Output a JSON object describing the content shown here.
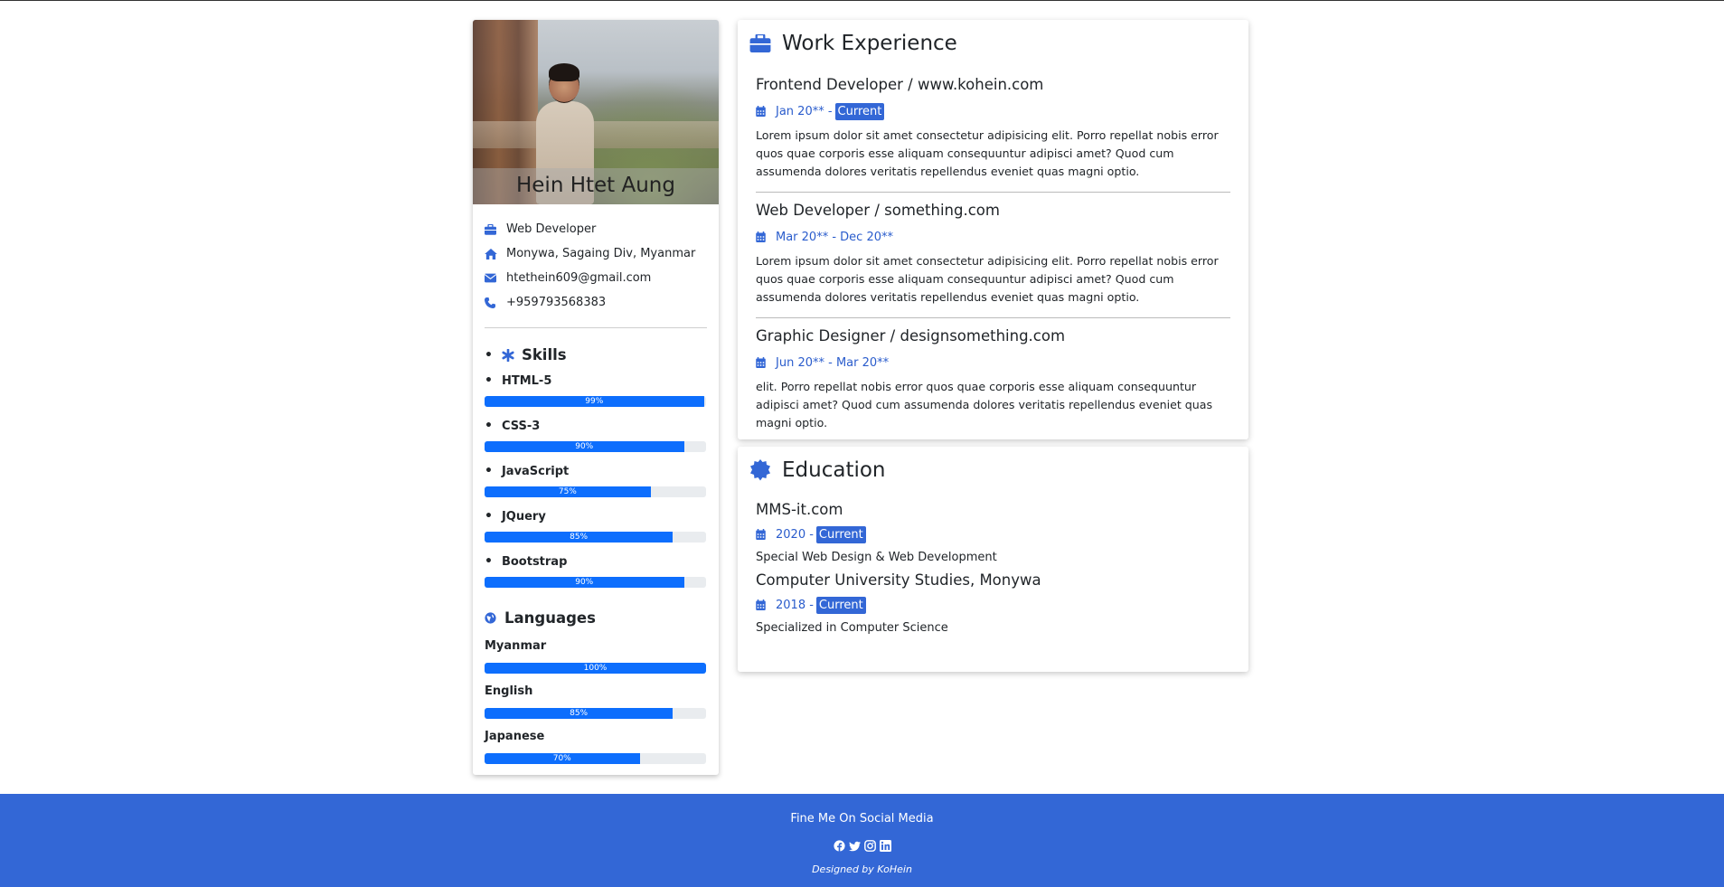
{
  "profile": {
    "name": "Hein Htet Aung",
    "job_title": "Web Developer",
    "location": "Monywa, Sagaing Div, Myanmar",
    "email": "htethein609@gmail.com",
    "phone": "+959793568383"
  },
  "skills": {
    "title": "Skills",
    "items": [
      {
        "name": "HTML-5",
        "percent": 99,
        "label": "99%"
      },
      {
        "name": "CSS-3",
        "percent": 90,
        "label": "90%"
      },
      {
        "name": "JavaScript",
        "percent": 75,
        "label": "75%"
      },
      {
        "name": "JQuery",
        "percent": 85,
        "label": "85%"
      },
      {
        "name": "Bootstrap",
        "percent": 90,
        "label": "90%"
      }
    ]
  },
  "languages": {
    "title": "Languages",
    "items": [
      {
        "name": "Myanmar",
        "percent": 100,
        "label": "100%"
      },
      {
        "name": "English",
        "percent": 85,
        "label": "85%"
      },
      {
        "name": "Japanese",
        "percent": 70,
        "label": "70%"
      }
    ]
  },
  "work": {
    "title": "Work Experience",
    "jobs": [
      {
        "title": "Frontend Developer / www.kohein.com",
        "date": "Jan 20** -",
        "badge": "Current",
        "desc": "Lorem ipsum dolor sit amet consectetur adipisicing elit. Porro repellat nobis error quos quae corporis esse aliquam consequuntur adipisci amet? Quod cum assumenda dolores veritatis repellendus eveniet quas magni optio."
      },
      {
        "title": "Web Developer / something.com",
        "date": "Mar 20** - Dec 20**",
        "badge": "",
        "desc": "Lorem ipsum dolor sit amet consectetur adipisicing elit. Porro repellat nobis error quos quae corporis esse aliquam consequuntur adipisci amet? Quod cum assumenda dolores veritatis repellendus eveniet quas magni optio."
      },
      {
        "title": "Graphic Designer / designsomething.com",
        "date": "Jun 20** - Mar 20**",
        "badge": "",
        "desc": "elit. Porro repellat nobis error quos quae corporis esse aliquam consequuntur adipisci amet? Quod cum assumenda dolores veritatis repellendus eveniet quas magni optio."
      }
    ]
  },
  "education": {
    "title": "Education",
    "items": [
      {
        "title": "MMS-it.com",
        "date": "2020 -",
        "badge": "Current",
        "desc": "Special Web Design & Web Development"
      },
      {
        "title": "Computer University Studies, Monywa",
        "date": "2018 -",
        "badge": "Current",
        "desc": "Specialized in Computer Science"
      }
    ]
  },
  "footer": {
    "heading": "Fine Me On Social Media",
    "icons": [
      "facebook-icon",
      "twitter-icon",
      "instagram-icon",
      "linkedin-icon"
    ],
    "credit": "Designed by KoHein"
  },
  "colors": {
    "accent": "#3367d6",
    "progress": "#0d6efd",
    "date_text": "#2a5ccc"
  }
}
